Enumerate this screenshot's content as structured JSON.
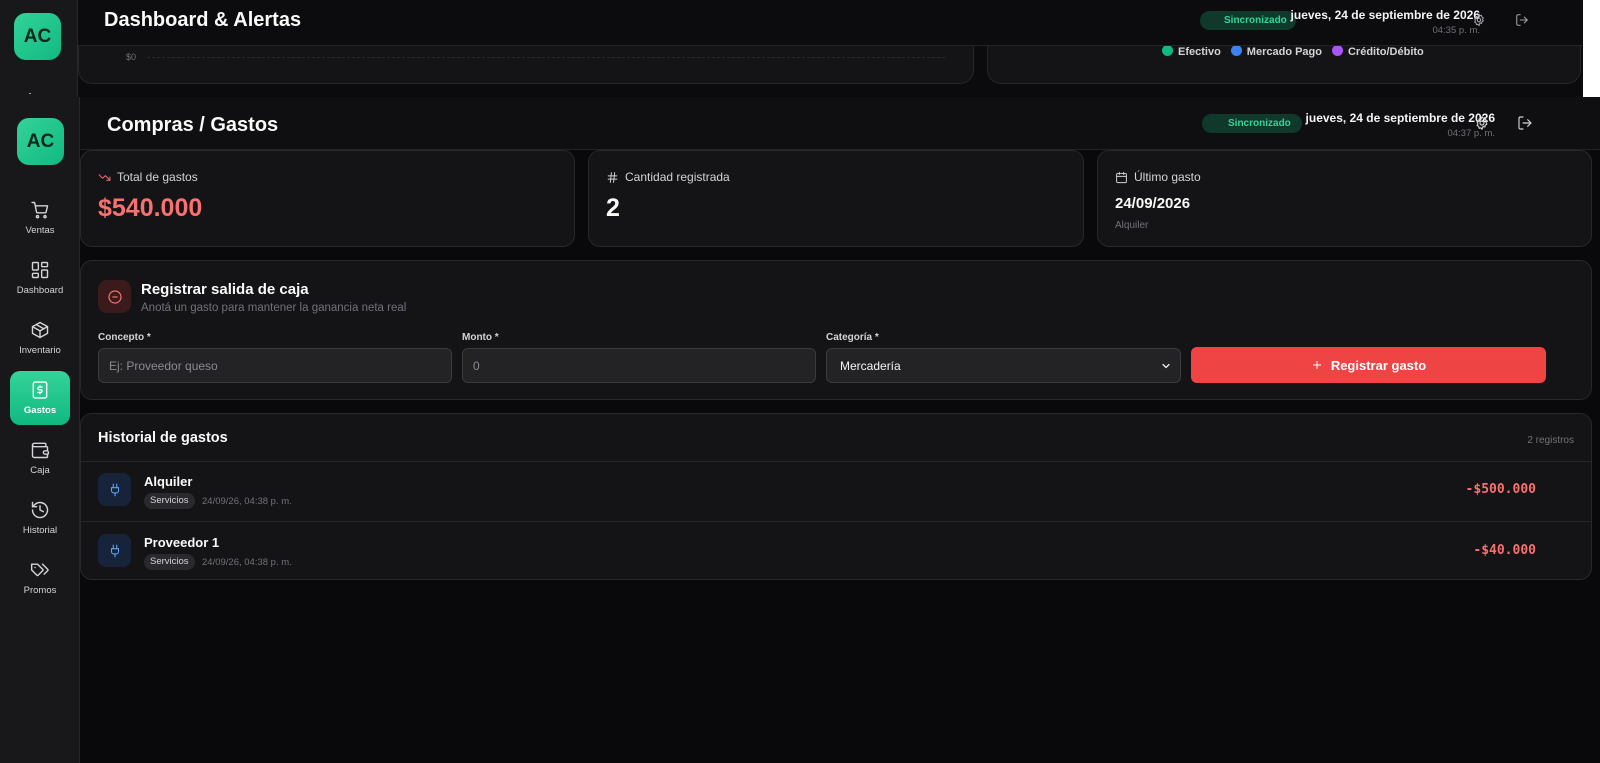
{
  "background_view": {
    "logo": "AC",
    "title": "Dashboard & Alertas",
    "sync_status": "Sincronizado",
    "date": "jueves, 24 de septiembre de 2026",
    "time": "04:35 p. m.",
    "chart_axis_zero": "$0",
    "legend": [
      {
        "label": "Efectivo",
        "color": "#10b981"
      },
      {
        "label": "Mercado Pago",
        "color": "#3b82f6"
      },
      {
        "label": "Crédito/Débito",
        "color": "#a855f7"
      }
    ]
  },
  "sidebar": {
    "logo": "AC",
    "items": [
      {
        "label": "Ventas",
        "icon": "cart-icon",
        "active": false
      },
      {
        "label": "Dashboard",
        "icon": "grid-icon",
        "active": false
      },
      {
        "label": "Inventario",
        "icon": "box-icon",
        "active": false
      },
      {
        "label": "Gastos",
        "icon": "receipt-dollar-icon",
        "active": true
      },
      {
        "label": "Caja",
        "icon": "wallet-icon",
        "active": false
      },
      {
        "label": "Historial",
        "icon": "history-icon",
        "active": false
      },
      {
        "label": "Promos",
        "icon": "tags-icon",
        "active": false
      }
    ]
  },
  "header": {
    "title": "Compras / Gastos",
    "sync_status": "Sincronizado",
    "date": "jueves, 24 de septiembre de 2026",
    "time": "04:37 p. m."
  },
  "stats": {
    "total": {
      "label": "Total de gastos",
      "value": "$540.000"
    },
    "count": {
      "label": "Cantidad registrada",
      "value": "2"
    },
    "last": {
      "label": "Último gasto",
      "value": "24/09/2026",
      "sub": "Alquiler"
    }
  },
  "form": {
    "title": "Registrar salida de caja",
    "subtitle": "Anotá un gasto para mantener la ganancia neta real",
    "concepto_label": "Concepto *",
    "concepto_placeholder": "Ej: Proveedor queso",
    "monto_label": "Monto *",
    "monto_placeholder": "0",
    "categoria_label": "Categoría *",
    "categoria_value": "Mercadería",
    "submit_label": "Registrar gasto"
  },
  "history": {
    "title": "Historial de gastos",
    "count": "2 registros",
    "rows": [
      {
        "name": "Alquiler",
        "category": "Servicios",
        "time": "24/09/26, 04:38 p. m.",
        "amount": "-$500.000"
      },
      {
        "name": "Proveedor 1",
        "category": "Servicios",
        "time": "24/09/26, 04:38 p. m.",
        "amount": "-$40.000"
      }
    ]
  },
  "colors": {
    "accent": "#10b981",
    "danger": "#ef4444",
    "background": "#09090b",
    "card": "#141416"
  }
}
